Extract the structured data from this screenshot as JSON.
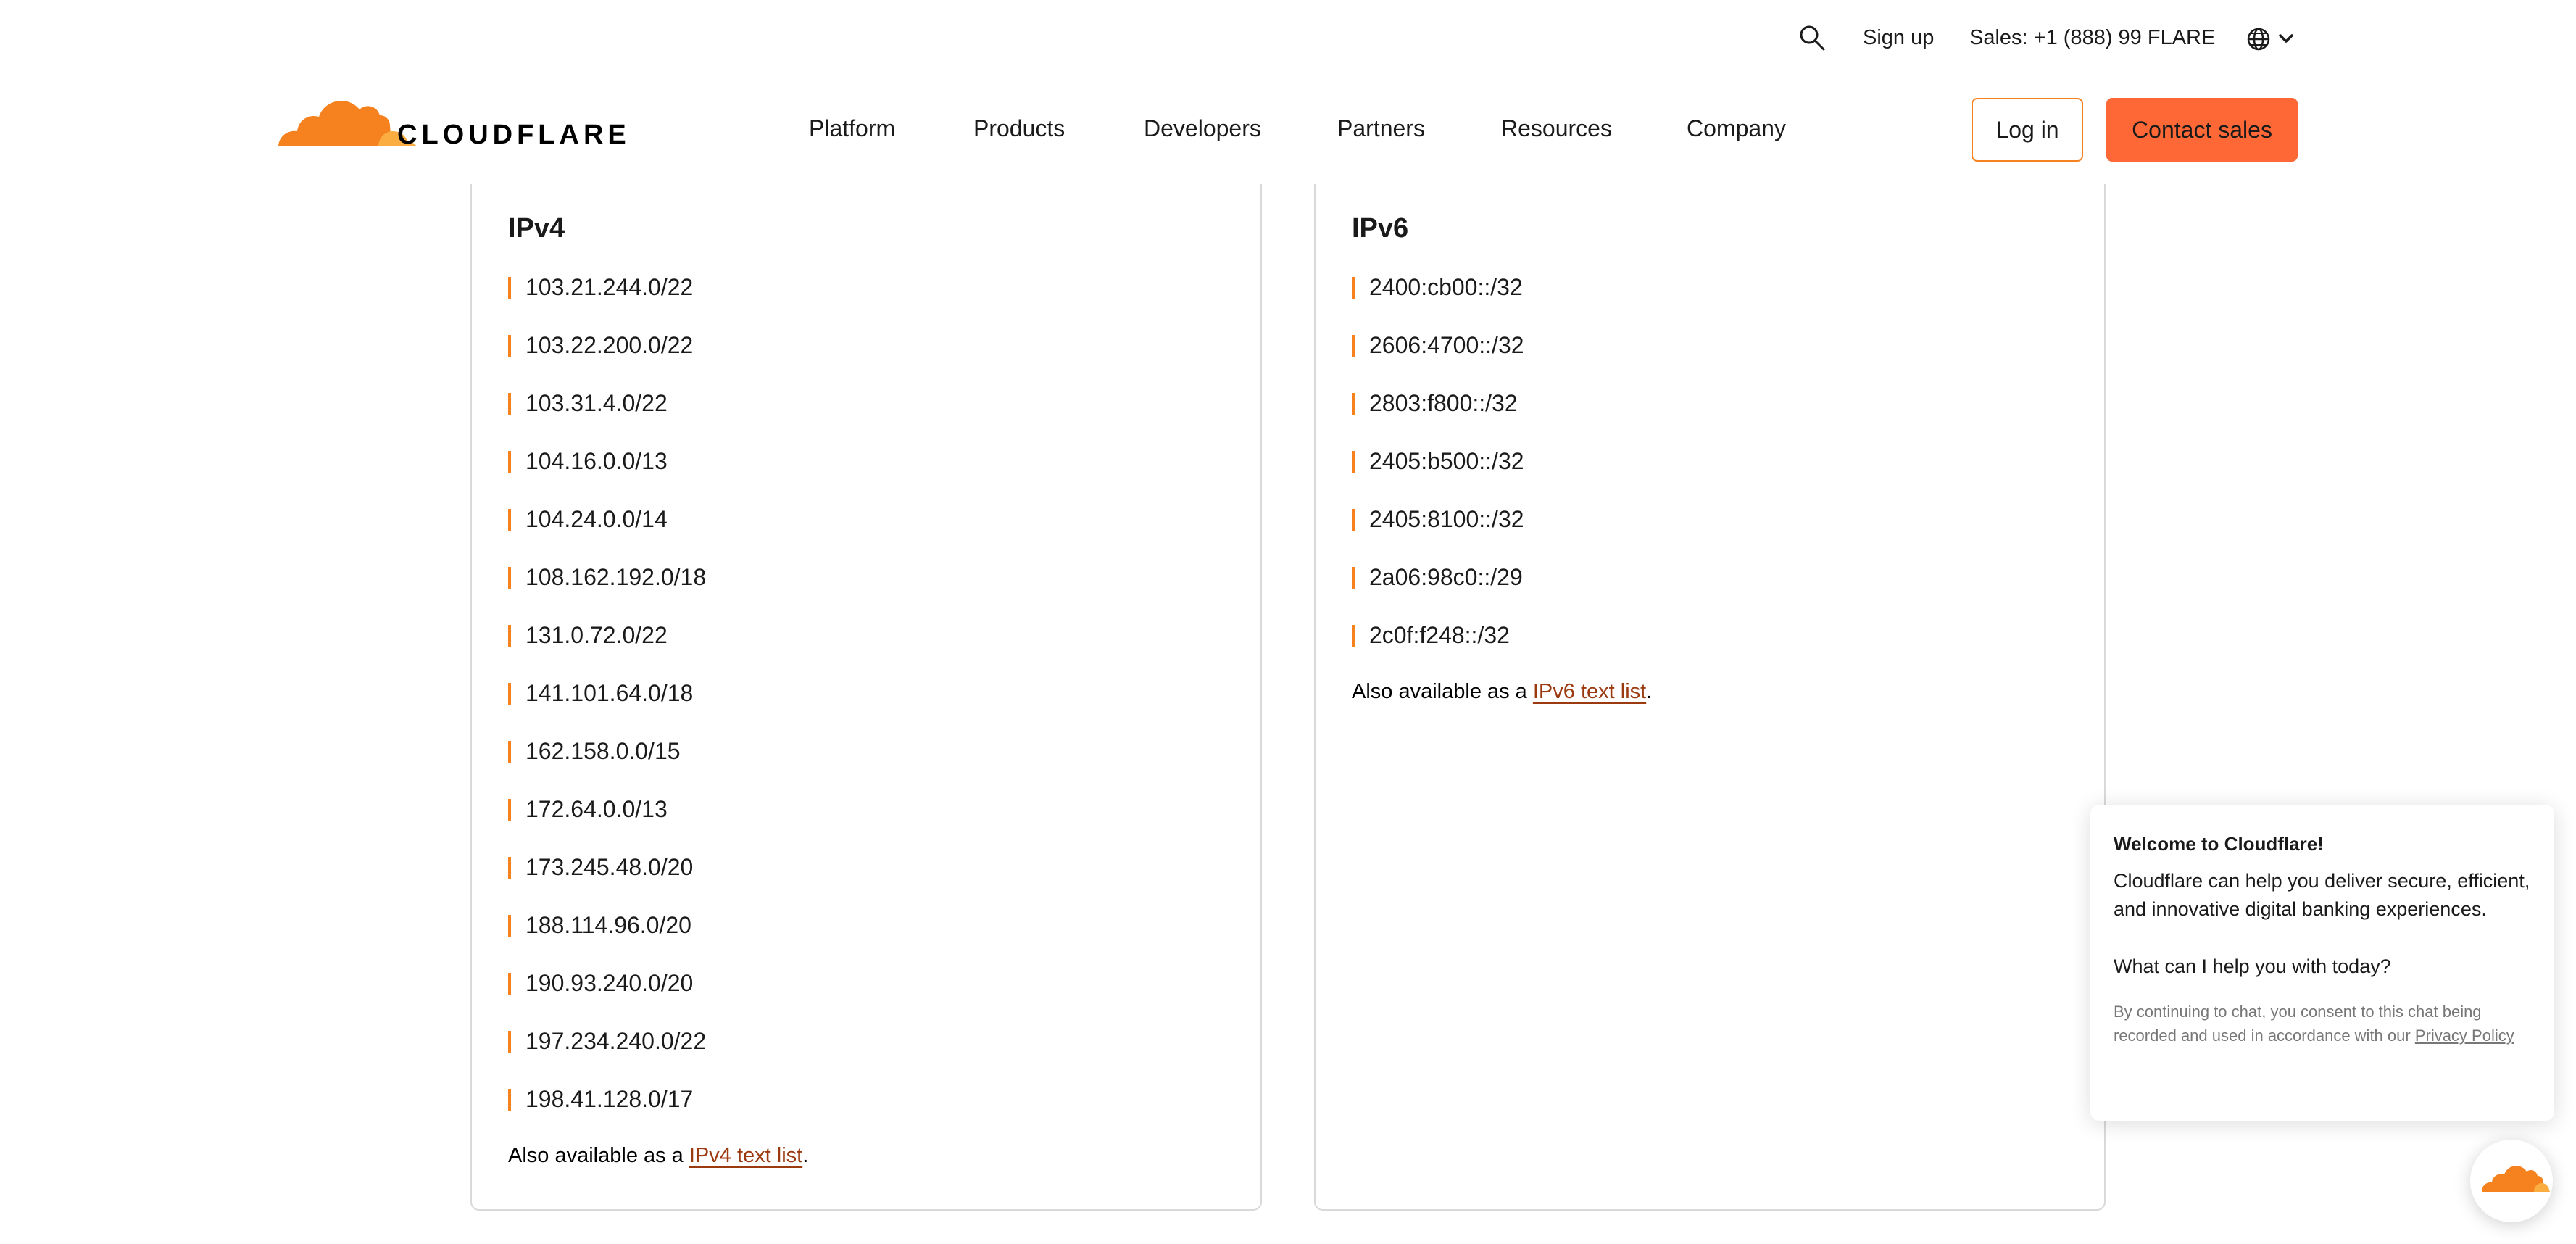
{
  "utility": {
    "search_icon": "search-icon",
    "signup_label": "Sign up",
    "sales_label": "Sales: +1 (888) 99 FLARE",
    "language_icon": "globe-icon"
  },
  "nav": {
    "logo_text": "CLOUDFLARE",
    "items": [
      {
        "label": "Platform"
      },
      {
        "label": "Products"
      },
      {
        "label": "Developers"
      },
      {
        "label": "Partners"
      },
      {
        "label": "Resources"
      },
      {
        "label": "Company"
      }
    ],
    "login_label": "Log in",
    "contact_label": "Contact sales"
  },
  "ipv4": {
    "title": "IPv4",
    "ranges": [
      "103.21.244.0/22",
      "103.22.200.0/22",
      "103.31.4.0/22",
      "104.16.0.0/13",
      "104.24.0.0/14",
      "108.162.192.0/18",
      "131.0.72.0/22",
      "141.101.64.0/18",
      "162.158.0.0/15",
      "172.64.0.0/13",
      "173.245.48.0/20",
      "188.114.96.0/20",
      "190.93.240.0/20",
      "197.234.240.0/22",
      "198.41.128.0/17"
    ],
    "also_prefix": "Also available as a ",
    "also_link": "IPv4 text list",
    "also_suffix": "."
  },
  "ipv6": {
    "title": "IPv6",
    "ranges": [
      "2400:cb00::/32",
      "2606:4700::/32",
      "2803:f800::/32",
      "2405:b500::/32",
      "2405:8100::/32",
      "2a06:98c0::/29",
      "2c0f:f248::/32"
    ],
    "also_prefix": "Also available as a ",
    "also_link": "IPv6 text list",
    "also_suffix": "."
  },
  "chat": {
    "title": "Welcome to Cloudflare!",
    "body": "Cloudflare can help you deliver secure, efficient, and innovative digital banking experiences.",
    "ask": "What can I help you with today?",
    "consent_text": "By continuing to chat, you consent to this chat being recorded and used in accordance with our ",
    "privacy_link": "Privacy Policy"
  },
  "colors": {
    "accent": "#f6821f",
    "cta": "#fd6836",
    "link": "#9c3a0f"
  }
}
